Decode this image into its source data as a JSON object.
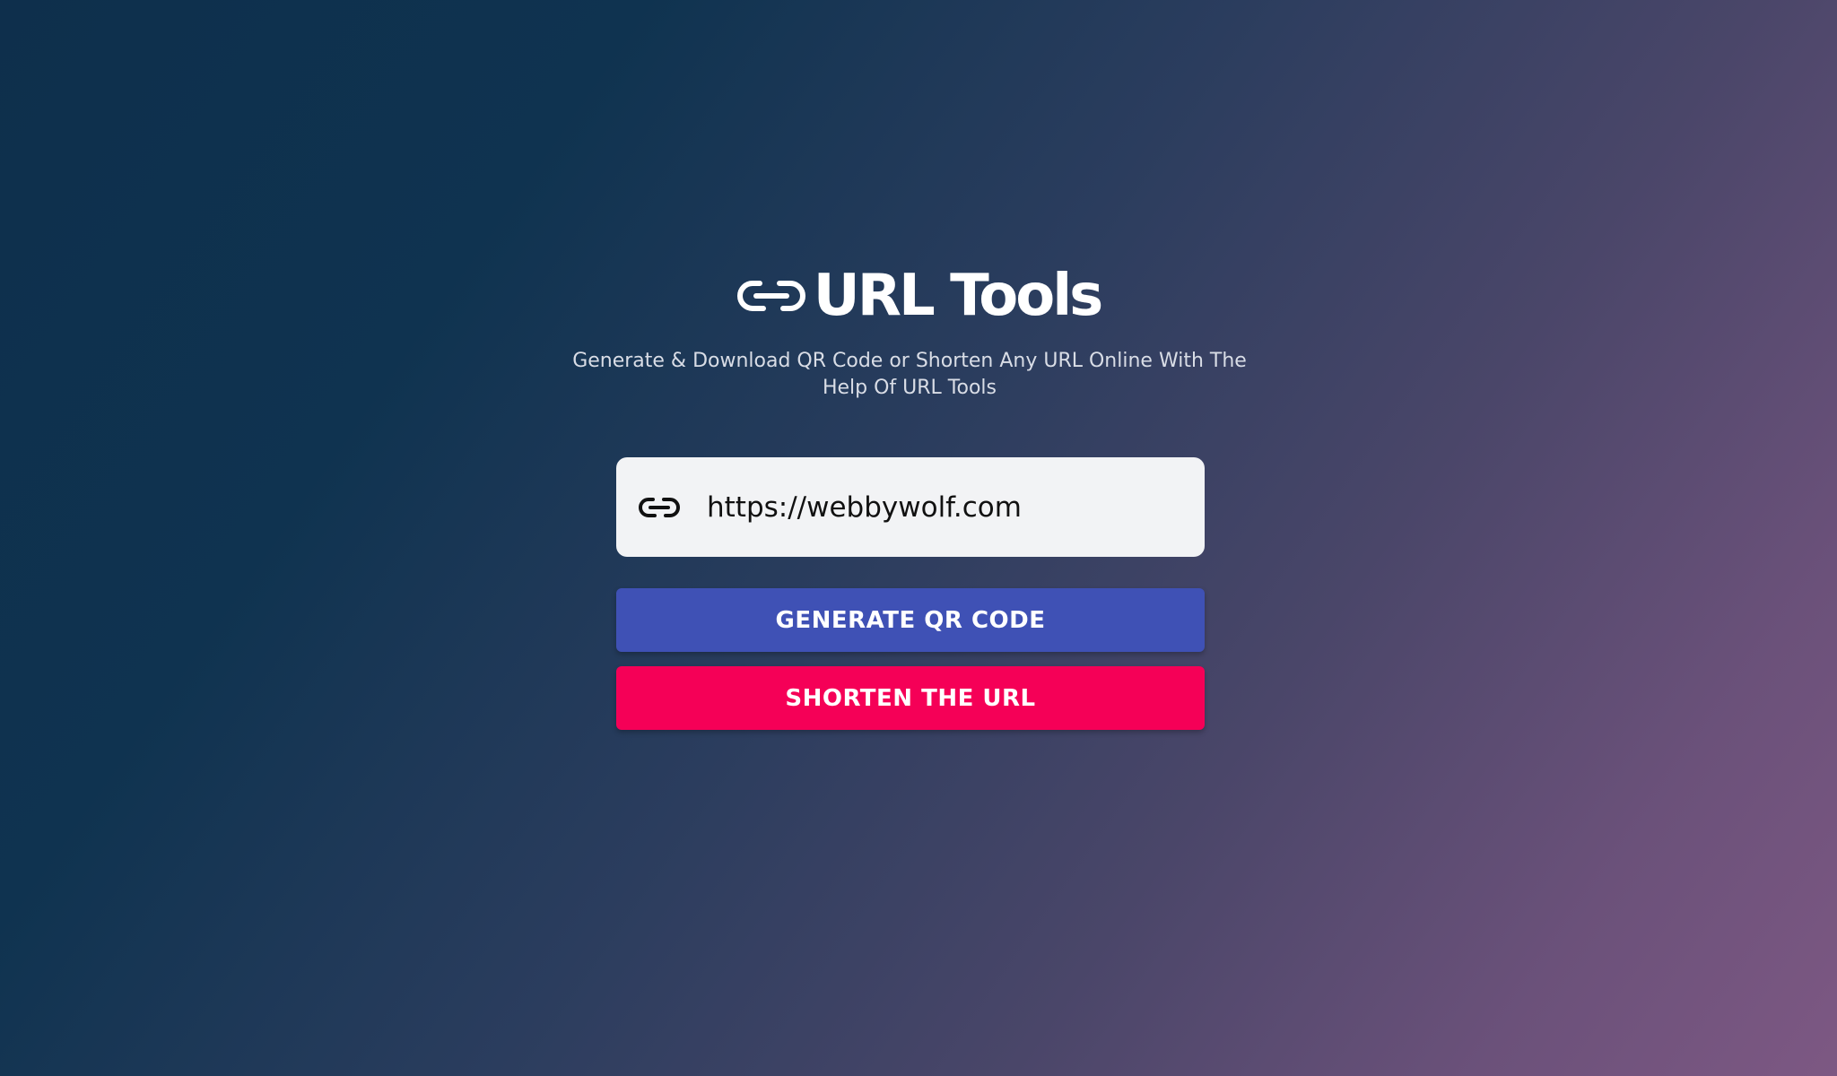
{
  "header": {
    "logo_icon": "link-icon",
    "title": "URL Tools",
    "subtitle": "Generate & Download QR Code or Shorten Any URL Online With The Help Of URL Tools"
  },
  "url_field": {
    "icon": "link-icon",
    "value": "https://webbywolf.com"
  },
  "buttons": {
    "generate_qr": "GENERATE QR CODE",
    "shorten": "SHORTEN THE URL"
  },
  "colors": {
    "primary_button": "#3f51b5",
    "secondary_button": "#f50057",
    "input_background": "#f2f3f5",
    "title_text": "#ffffff"
  }
}
